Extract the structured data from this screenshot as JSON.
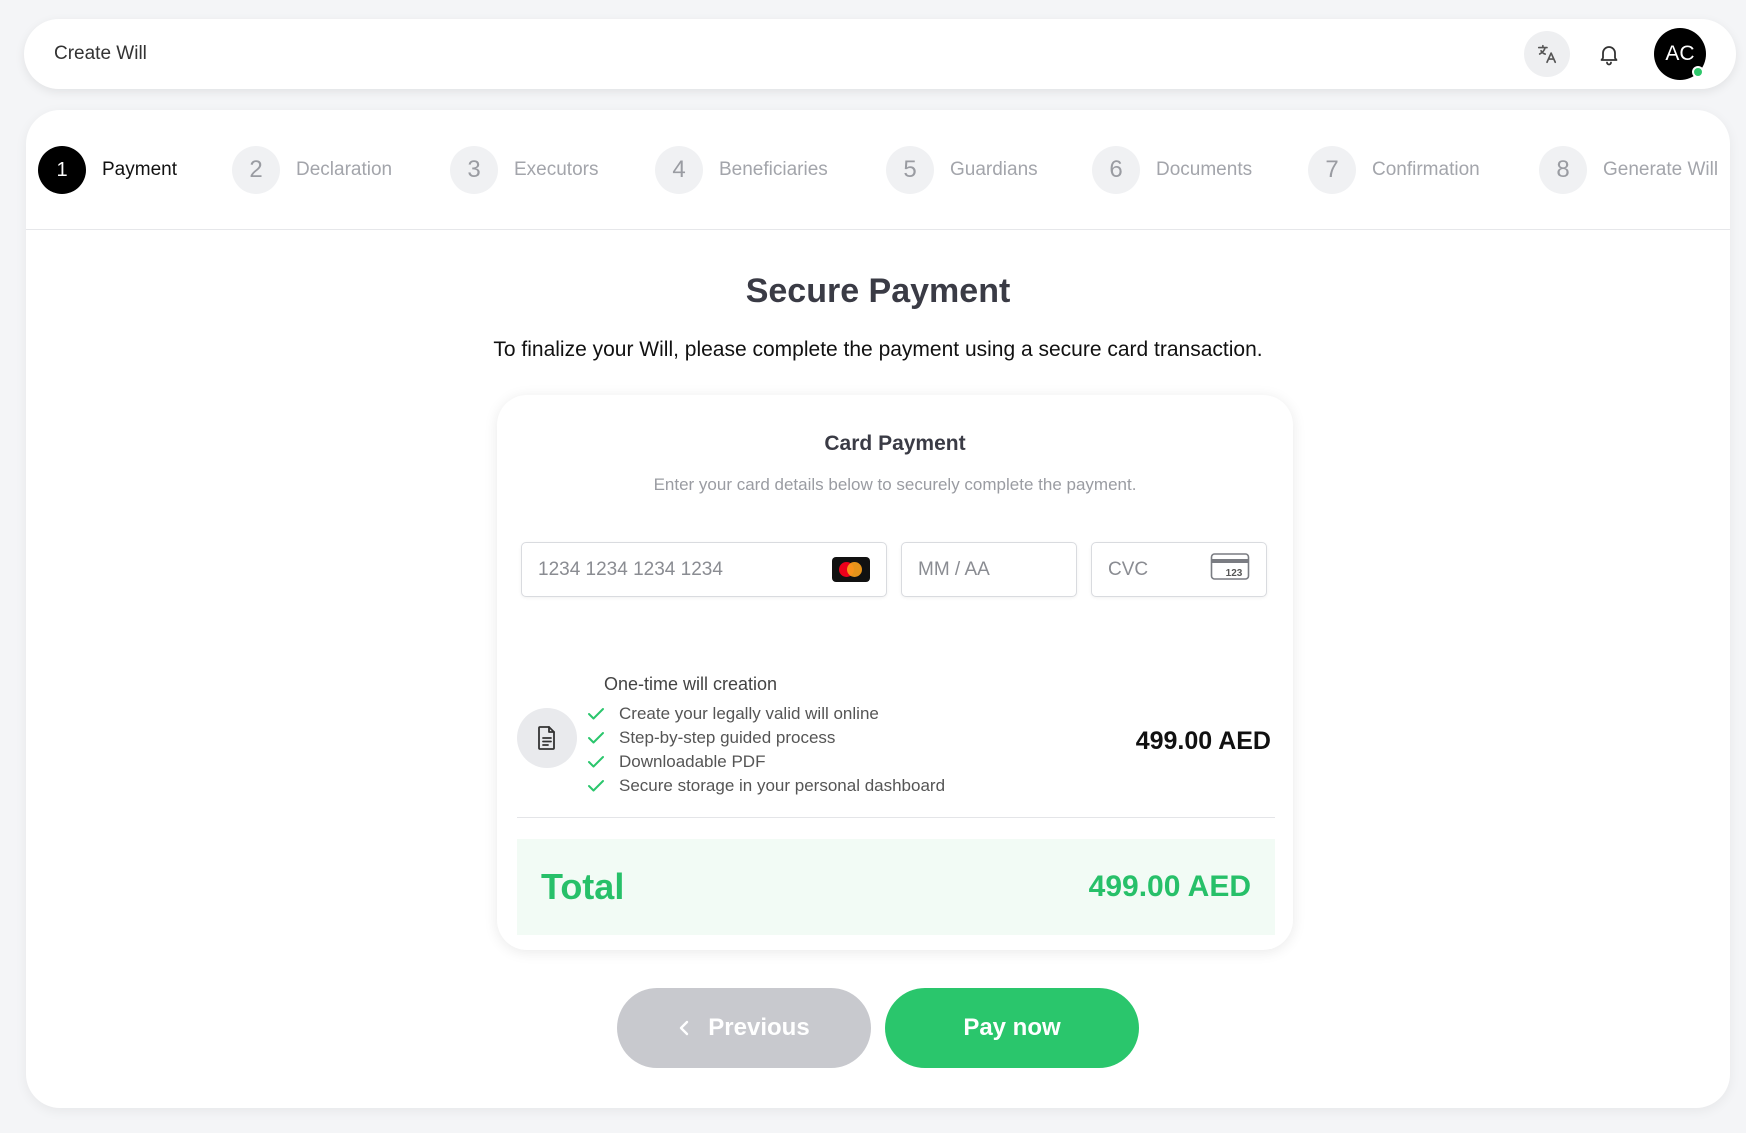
{
  "topbar": {
    "title": "Create Will",
    "avatar_initials": "AC",
    "icons": [
      "translate-icon",
      "bell-icon"
    ]
  },
  "stepper": {
    "steps": [
      {
        "num": "1",
        "label": "Payment",
        "active": true
      },
      {
        "num": "2",
        "label": "Declaration",
        "active": false
      },
      {
        "num": "3",
        "label": "Executors",
        "active": false
      },
      {
        "num": "4",
        "label": "Beneficiaries",
        "active": false
      },
      {
        "num": "5",
        "label": "Guardians",
        "active": false
      },
      {
        "num": "6",
        "label": "Documents",
        "active": false
      },
      {
        "num": "7",
        "label": "Confirmation",
        "active": false
      },
      {
        "num": "8",
        "label": "Generate Will",
        "active": false
      }
    ]
  },
  "page": {
    "heading": "Secure Payment",
    "subheading": "To finalize your Will, please complete the payment using a secure card transaction."
  },
  "card_payment": {
    "title": "Card Payment",
    "subtitle": "Enter your card details below to securely complete the payment.",
    "card_number_placeholder": "1234 1234 1234 1234",
    "expiry_placeholder": "MM / AA",
    "cvc_placeholder": "CVC",
    "cvc_icon_text": "123"
  },
  "order": {
    "product_title": "One-time will creation",
    "features": [
      "Create your legally valid will online",
      "Step-by-step guided process",
      "Downloadable PDF",
      "Secure storage in your personal dashboard"
    ],
    "price": "499.00 AED",
    "total_label": "Total",
    "total_value": "499.00 AED"
  },
  "actions": {
    "previous_label": "Previous",
    "pay_label": "Pay now"
  },
  "colors": {
    "accent_green": "#2ac66c",
    "active_step": "#000000",
    "disabled_button": "#c8c9ce"
  }
}
